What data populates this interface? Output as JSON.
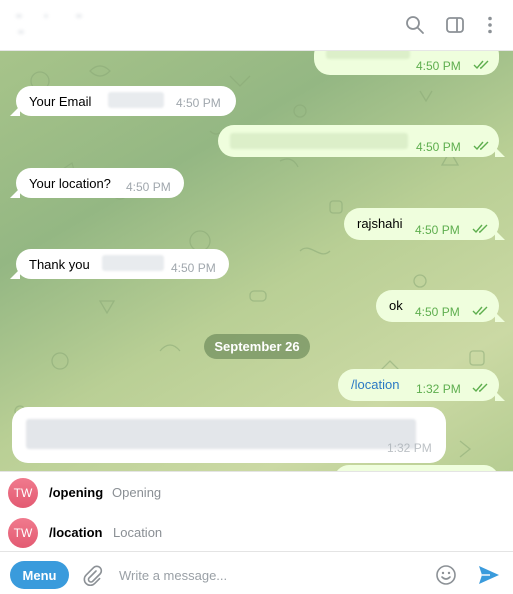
{
  "header": {
    "icons": [
      "search-icon",
      "sidebar-toggle-icon",
      "more-vertical-icon"
    ]
  },
  "messages": {
    "m0": {
      "time": "4:50 PM"
    },
    "m1": {
      "text": "Your Email",
      "time": "4:50 PM"
    },
    "m2": {
      "time": "4:50 PM"
    },
    "m3": {
      "text": "Your location?",
      "time": "4:50 PM"
    },
    "m4": {
      "text": "rajshahi",
      "time": "4:50 PM"
    },
    "m5": {
      "text": "Thank you",
      "time": "4:50 PM"
    },
    "m6": {
      "text": "ok",
      "time": "4:50 PM"
    },
    "date_separator": "September 26",
    "m7": {
      "text": "/location",
      "time": "1:32 PM"
    },
    "m8": {
      "time": "1:32 PM"
    }
  },
  "commands": [
    {
      "avatar": "TW",
      "name": "/opening",
      "description": "Opening"
    },
    {
      "avatar": "TW",
      "name": "/location",
      "description": "Location"
    }
  ],
  "composer": {
    "menu_label": "Menu",
    "placeholder": "Write a message...",
    "icons": [
      "attach-icon",
      "emoji-icon",
      "send-icon"
    ]
  },
  "colors": {
    "accent": "#3a9bdc",
    "outgoing_bubble": "#effedd",
    "incoming_bubble": "#ffffff",
    "read_ticks": "#5eae4e",
    "avatar": "#e35a72"
  }
}
